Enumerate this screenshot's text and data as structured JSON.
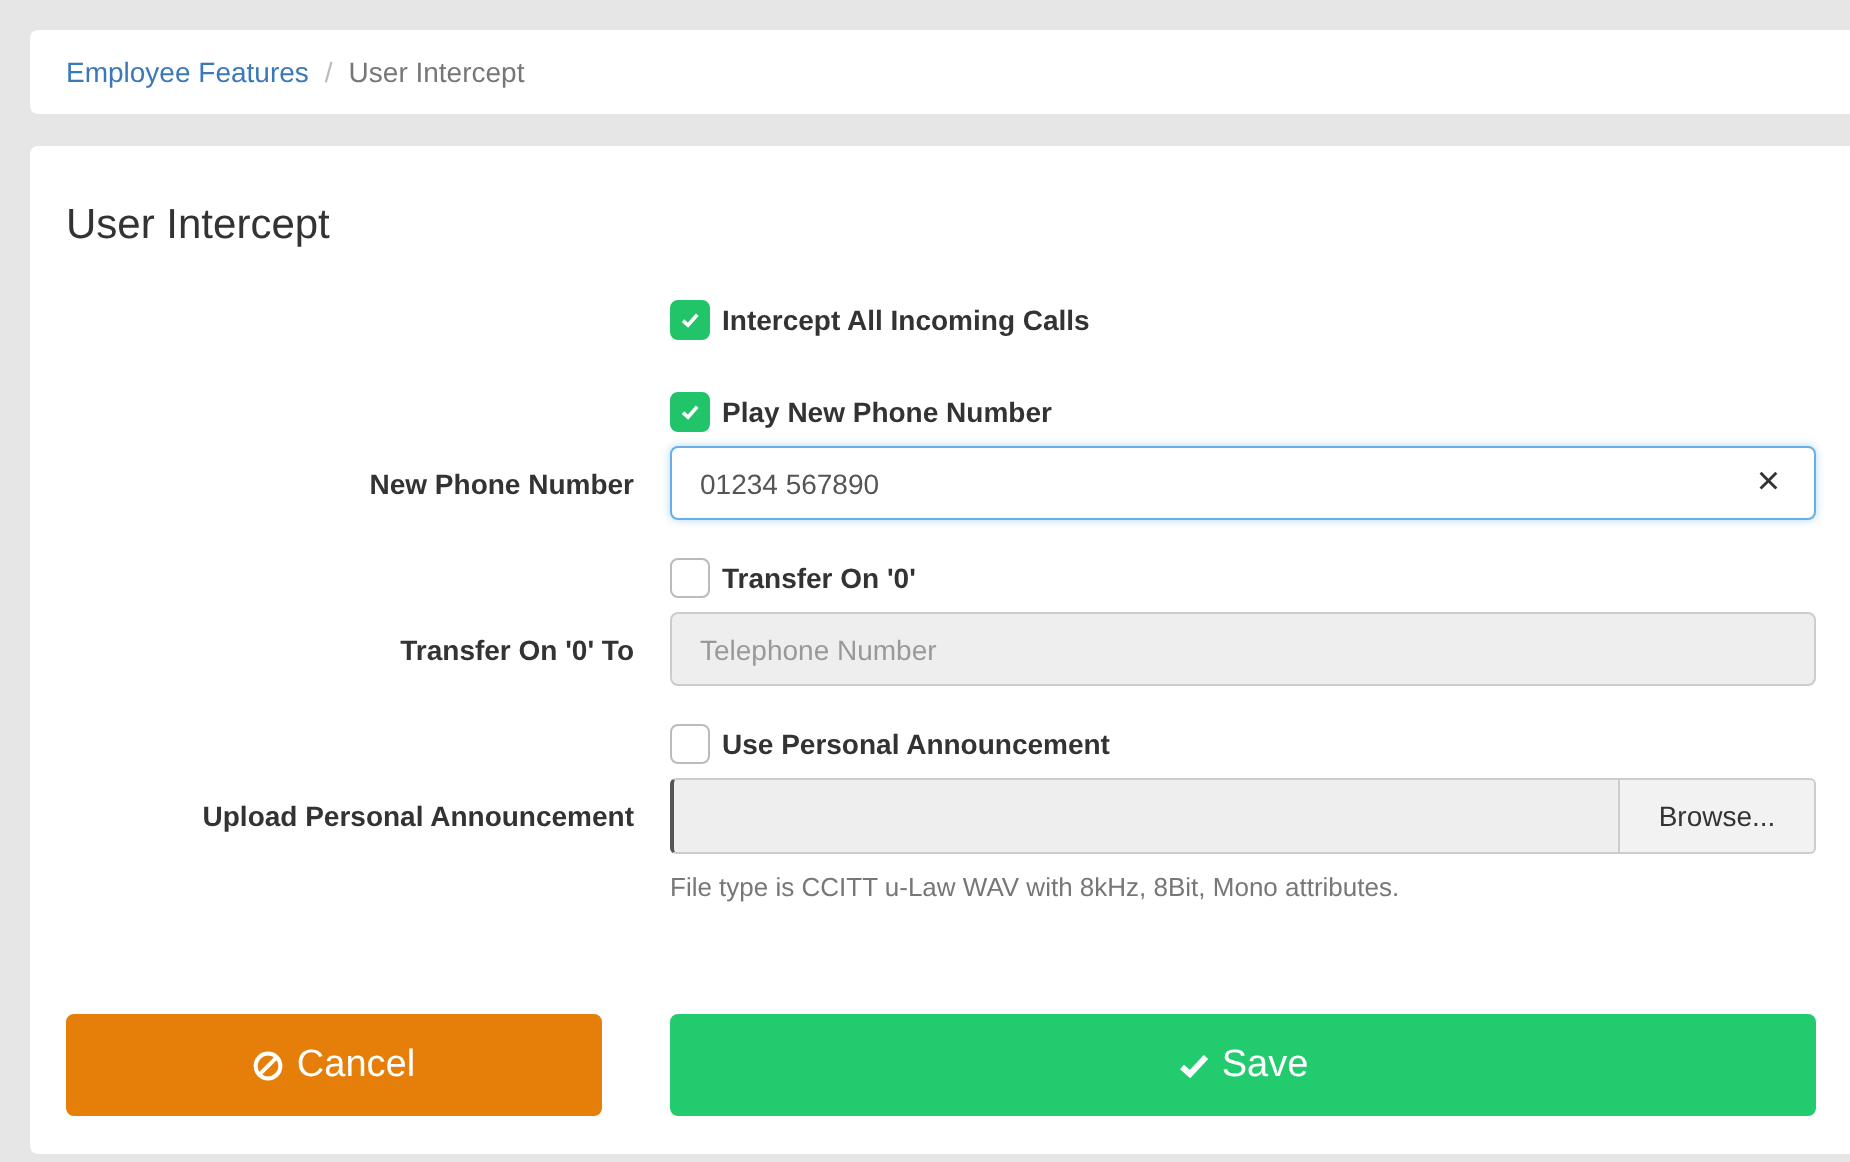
{
  "breadcrumb": [
    {
      "label": "Employee Features",
      "link": true
    },
    {
      "label": "User Intercept",
      "link": false
    }
  ],
  "breadcrumb_separator": "/",
  "form": {
    "title": "User Intercept",
    "rows": [
      {
        "kind": "checkbox",
        "label": "Intercept All Incoming Calls",
        "checked": true
      },
      {
        "kind": "checkbox",
        "label": "Play New Phone Number",
        "checked": true
      },
      {
        "kind": "text",
        "label": "New Phone Number",
        "value": "01234 567890",
        "clear": "×",
        "disabled": false
      },
      {
        "kind": "checkbox",
        "label": "Transfer On '0'",
        "checked": false
      },
      {
        "kind": "text",
        "label": "Transfer On '0' To",
        "placeholder": "Telephone Number",
        "disabled": true
      },
      {
        "kind": "checkbox",
        "label": "Use Personal Announcement",
        "checked": false
      },
      {
        "kind": "file",
        "label": "Upload Personal Announcement",
        "button": "Browse...",
        "help": "File type is CCITT u-Law WAV with 8kHz, 8Bit, Mono attributes."
      }
    ]
  },
  "buttons": [
    {
      "kind": "cancel",
      "label": "Cancel"
    },
    {
      "kind": "save",
      "label": "Save"
    }
  ]
}
